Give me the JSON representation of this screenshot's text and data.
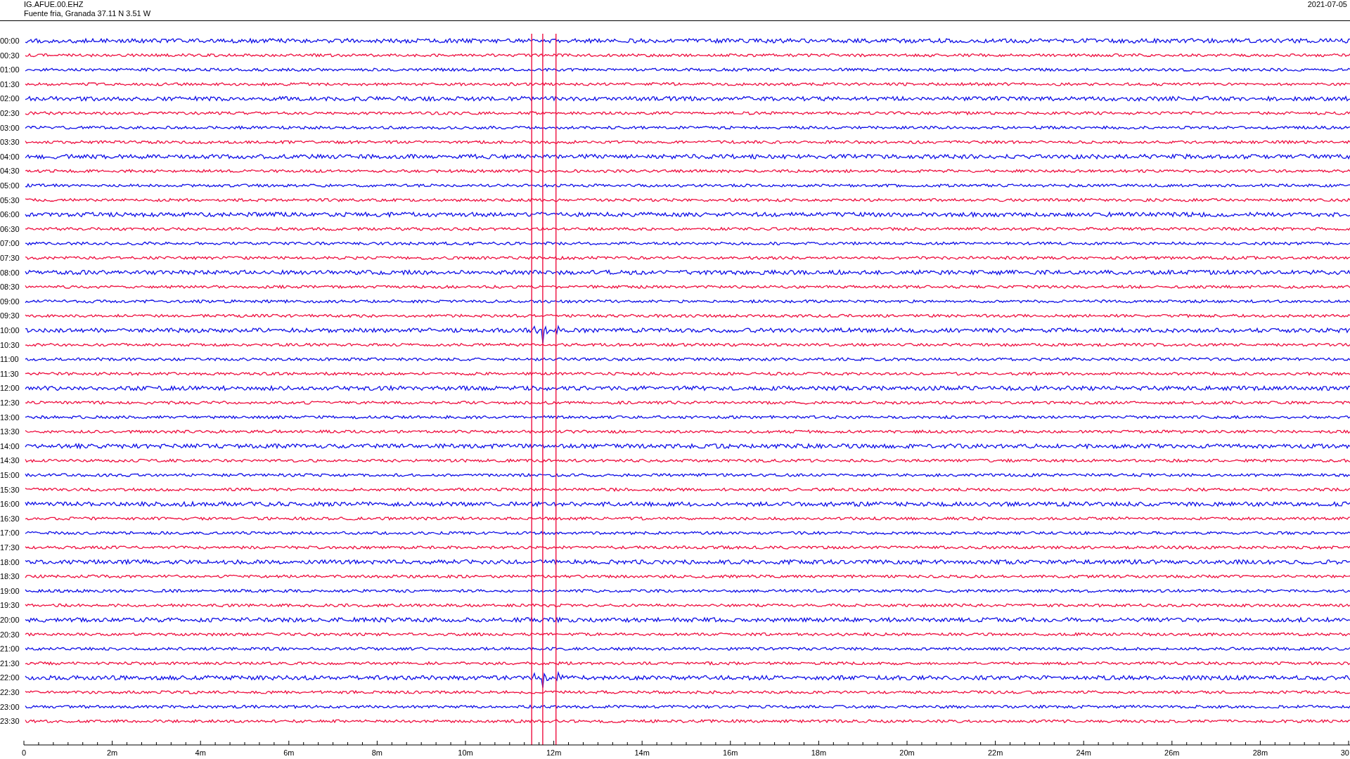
{
  "header": {
    "station": "IG.AFUE.00.EHZ",
    "location": "Fuente fria, Granada  37.11 N 3.51 W",
    "date": "2021-07-05"
  },
  "rows": [
    {
      "label": "00:00",
      "color": "#1010e6"
    },
    {
      "label": "00:30",
      "color": "#ee1040"
    },
    {
      "label": "01:00",
      "color": "#1010e6"
    },
    {
      "label": "01:30",
      "color": "#ee1040"
    },
    {
      "label": "02:00",
      "color": "#1010e6"
    },
    {
      "label": "02:30",
      "color": "#ee1040"
    },
    {
      "label": "03:00",
      "color": "#1010e6"
    },
    {
      "label": "03:30",
      "color": "#ee1040"
    },
    {
      "label": "04:00",
      "color": "#1010e6"
    },
    {
      "label": "04:30",
      "color": "#ee1040"
    },
    {
      "label": "05:00",
      "color": "#1010e6"
    },
    {
      "label": "05:30",
      "color": "#ee1040"
    },
    {
      "label": "06:00",
      "color": "#1010e6"
    },
    {
      "label": "06:30",
      "color": "#ee1040"
    },
    {
      "label": "07:00",
      "color": "#1010e6"
    },
    {
      "label": "07:30",
      "color": "#ee1040"
    },
    {
      "label": "08:00",
      "color": "#1010e6"
    },
    {
      "label": "08:30",
      "color": "#ee1040"
    },
    {
      "label": "09:00",
      "color": "#1010e6"
    },
    {
      "label": "09:30",
      "color": "#ee1040"
    },
    {
      "label": "10:00",
      "color": "#1010e6"
    },
    {
      "label": "10:30",
      "color": "#ee1040"
    },
    {
      "label": "11:00",
      "color": "#1010e6"
    },
    {
      "label": "11:30",
      "color": "#ee1040"
    },
    {
      "label": "12:00",
      "color": "#1010e6"
    },
    {
      "label": "12:30",
      "color": "#ee1040"
    },
    {
      "label": "13:00",
      "color": "#1010e6"
    },
    {
      "label": "13:30",
      "color": "#ee1040"
    },
    {
      "label": "14:00",
      "color": "#1010e6"
    },
    {
      "label": "14:30",
      "color": "#ee1040"
    },
    {
      "label": "15:00",
      "color": "#1010e6"
    },
    {
      "label": "15:30",
      "color": "#ee1040"
    },
    {
      "label": "16:00",
      "color": "#1010e6"
    },
    {
      "label": "16:30",
      "color": "#ee1040"
    },
    {
      "label": "17:00",
      "color": "#1010e6"
    },
    {
      "label": "17:30",
      "color": "#ee1040"
    },
    {
      "label": "18:00",
      "color": "#1010e6"
    },
    {
      "label": "18:30",
      "color": "#ee1040"
    },
    {
      "label": "19:00",
      "color": "#1010e6"
    },
    {
      "label": "19:30",
      "color": "#ee1040"
    },
    {
      "label": "20:00",
      "color": "#1010e6"
    },
    {
      "label": "20:30",
      "color": "#ee1040"
    },
    {
      "label": "21:00",
      "color": "#1010e6"
    },
    {
      "label": "21:30",
      "color": "#ee1040"
    },
    {
      "label": "22:00",
      "color": "#1010e6"
    },
    {
      "label": "22:30",
      "color": "#ee1040"
    },
    {
      "label": "23:00",
      "color": "#1010e6"
    },
    {
      "label": "23:30",
      "color": "#ee1040"
    }
  ],
  "x_ticks": [
    "0",
    "2m",
    "4m",
    "6m",
    "8m",
    "10m",
    "12m",
    "14m",
    "16m",
    "18m",
    "20m",
    "22m",
    "24m",
    "26m",
    "28m",
    "30"
  ]
}
